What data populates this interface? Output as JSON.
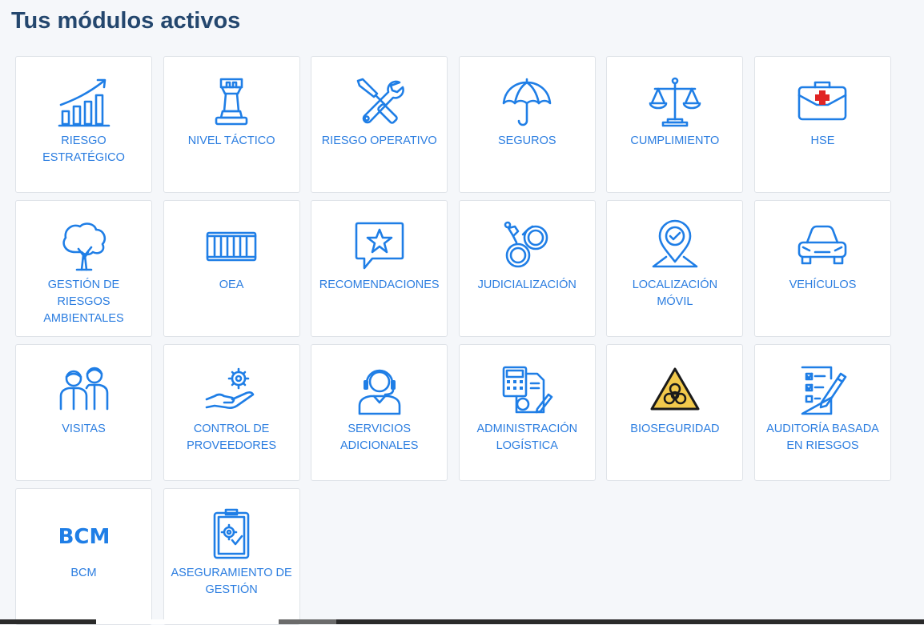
{
  "page": {
    "title": "Tus módulos activos"
  },
  "modules": [
    {
      "label": "RIESGO ESTRATÉGICO",
      "icon": "growth-chart-icon"
    },
    {
      "label": "NIVEL TÁCTICO",
      "icon": "chess-rook-icon"
    },
    {
      "label": "RIESGO OPERATIVO",
      "icon": "screwdriver-wrench-icon"
    },
    {
      "label": "SEGUROS",
      "icon": "umbrella-icon"
    },
    {
      "label": "CUMPLIMIENTO",
      "icon": "scales-icon"
    },
    {
      "label": "HSE",
      "icon": "first-aid-kit-icon"
    },
    {
      "label": "GESTIÓN DE RIESGOS AMBIENTALES",
      "icon": "tree-icon"
    },
    {
      "label": "OEA",
      "icon": "container-icon"
    },
    {
      "label": "RECOMENDACIONES",
      "icon": "star-chat-icon"
    },
    {
      "label": "JUDICIALIZACIÓN",
      "icon": "handcuffs-icon"
    },
    {
      "label": "LOCALIZACIÓN MÓVIL",
      "icon": "location-pin-icon"
    },
    {
      "label": "VEHÍCULOS",
      "icon": "car-icon"
    },
    {
      "label": "VISITAS",
      "icon": "visitors-icon"
    },
    {
      "label": "CONTROL DE PROVEEDORES",
      "icon": "hand-gear-icon"
    },
    {
      "label": "SERVICIOS ADICIONALES",
      "icon": "headset-agent-icon"
    },
    {
      "label": "ADMINISTRACIÓN LOGÍSTICA",
      "icon": "calculator-document-icon"
    },
    {
      "label": "BIOSEGURIDAD",
      "icon": "biohazard-icon"
    },
    {
      "label": "AUDITORÍA BASADA EN RIESGOS",
      "icon": "checklist-pen-icon"
    },
    {
      "label": "BCM",
      "icon": "bcm-text-icon",
      "icon_text": "BCM"
    },
    {
      "label": "ASEGURAMIENTO DE GESTIÓN",
      "icon": "clipboard-gear-icon"
    }
  ],
  "colors": {
    "title": "#24476e",
    "accent": "#1f7ee6",
    "label": "#2b7de0",
    "background": "#f5f7fa",
    "biohazard_fill": "#f2c94c"
  }
}
